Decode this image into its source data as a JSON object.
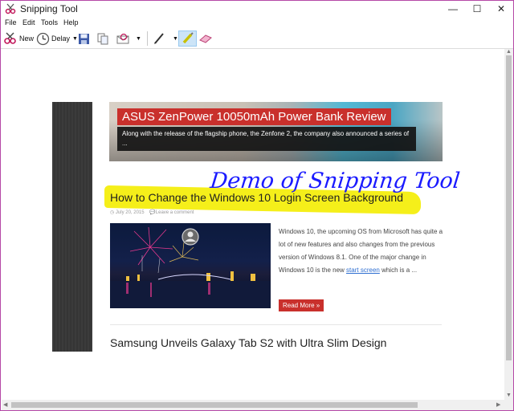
{
  "window": {
    "title": "Snipping Tool",
    "controls": {
      "minimize": "—",
      "maximize": "☐",
      "close": "✕"
    }
  },
  "menu": [
    "File",
    "Edit",
    "Tools",
    "Help"
  ],
  "toolbar": {
    "new_label": "New",
    "delay_label": "Delay",
    "tools": [
      "new-snip-icon",
      "delay-clock-icon",
      "save-icon",
      "copy-icon",
      "send-email-icon",
      "pen-icon",
      "highlighter-icon",
      "eraser-icon"
    ]
  },
  "page": {
    "banner": {
      "title": "ASUS ZenPower 10050mAh Power Bank Review",
      "excerpt": "Along with the release of the flagship phone, the Zenfone 2, the company also announced a series of ..."
    },
    "annotation": "Demo of Snipping Tool",
    "post": {
      "title": "How to Change the Windows 10 Login Screen Background",
      "date": "July 20, 2015",
      "comment": "Leave a comment",
      "excerpt_before": "Windows 10, the upcoming OS from Microsoft has quite a lot of new features and also changes from the previous version of Windows 8.1. One of the major change in Windows 10 is the new ",
      "excerpt_link": "start screen",
      "excerpt_after": " which is a ...",
      "read_more": "Read More »"
    },
    "next_post_title": "Samsung Unveils Galaxy Tab S2 with Ultra Slim Design"
  },
  "colors": {
    "accent_red": "#c9302c",
    "highlighter": "#f5ef1a",
    "ink": "#1a1aff",
    "window_border": "#b548a7"
  }
}
